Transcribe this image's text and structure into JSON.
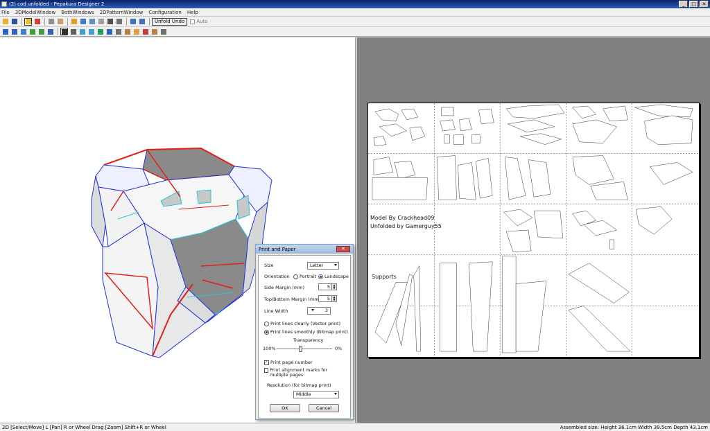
{
  "window": {
    "title": "(2) cod unfolded - Pepakura Designer 2",
    "controls": [
      "_",
      "□",
      "✕"
    ]
  },
  "menu": [
    "File",
    "3DModelWindow",
    "BothWindows",
    "2DPatternWindow",
    "Configuration",
    "Help"
  ],
  "toolbar": {
    "unfold_undo_label": "Unfold Undo",
    "auto_label": "Auto"
  },
  "sheet": {
    "text_model_by": "Model By Crackhead09",
    "text_unfolded_by": "Unfolded by Gamerguy55",
    "text_supports": "Supports"
  },
  "status": {
    "left": "2D [Select/Move] L [Pan] R or Wheel Drag [Zoom] Shift+R or Wheel",
    "right": "Assembled size: Height 36.1cm Width 39.5cm Depth 43.1cm"
  },
  "dialog": {
    "title": "Print and Paper",
    "close_label": "✕",
    "size_label": "Size",
    "size_value": "Letter",
    "orientation_label": "Orientation",
    "portrait_label": "Portrait",
    "landscape_label": "Landscape",
    "side_margin_label": "Side Margin (mm)",
    "side_margin_value": "5",
    "topbottom_margin_label": "Top/Bottom Margin (mm)",
    "topbottom_margin_value": "5",
    "line_width_label": "Line Width",
    "line_width_value": "3",
    "vector_print_label": "Print lines clearly (Vector print)",
    "bitmap_print_label": "Print lines smoothly (Bitmap print)",
    "transparency_label": "Transparency",
    "transparency_min": "100%",
    "transparency_max": "0%",
    "transparency_level": 0.42,
    "page_number_label": "Print page number",
    "alignment_marks_label": "Print alignment marks for multiple pages",
    "resolution_label": "Resolution (for bitmap print)",
    "resolution_value": "Middle",
    "ok_label": "OK",
    "cancel_label": "Cancel",
    "page_number_checked": true,
    "alignment_marks_checked": false,
    "orientation_value": "landscape",
    "print_mode": "bitmap"
  },
  "colors": {
    "model_red": "#e0201a",
    "model_blue": "#2030d8",
    "model_cyan": "#20c8d8",
    "model_gray": "#8a8a8a",
    "workspace_gray": "#808080"
  }
}
